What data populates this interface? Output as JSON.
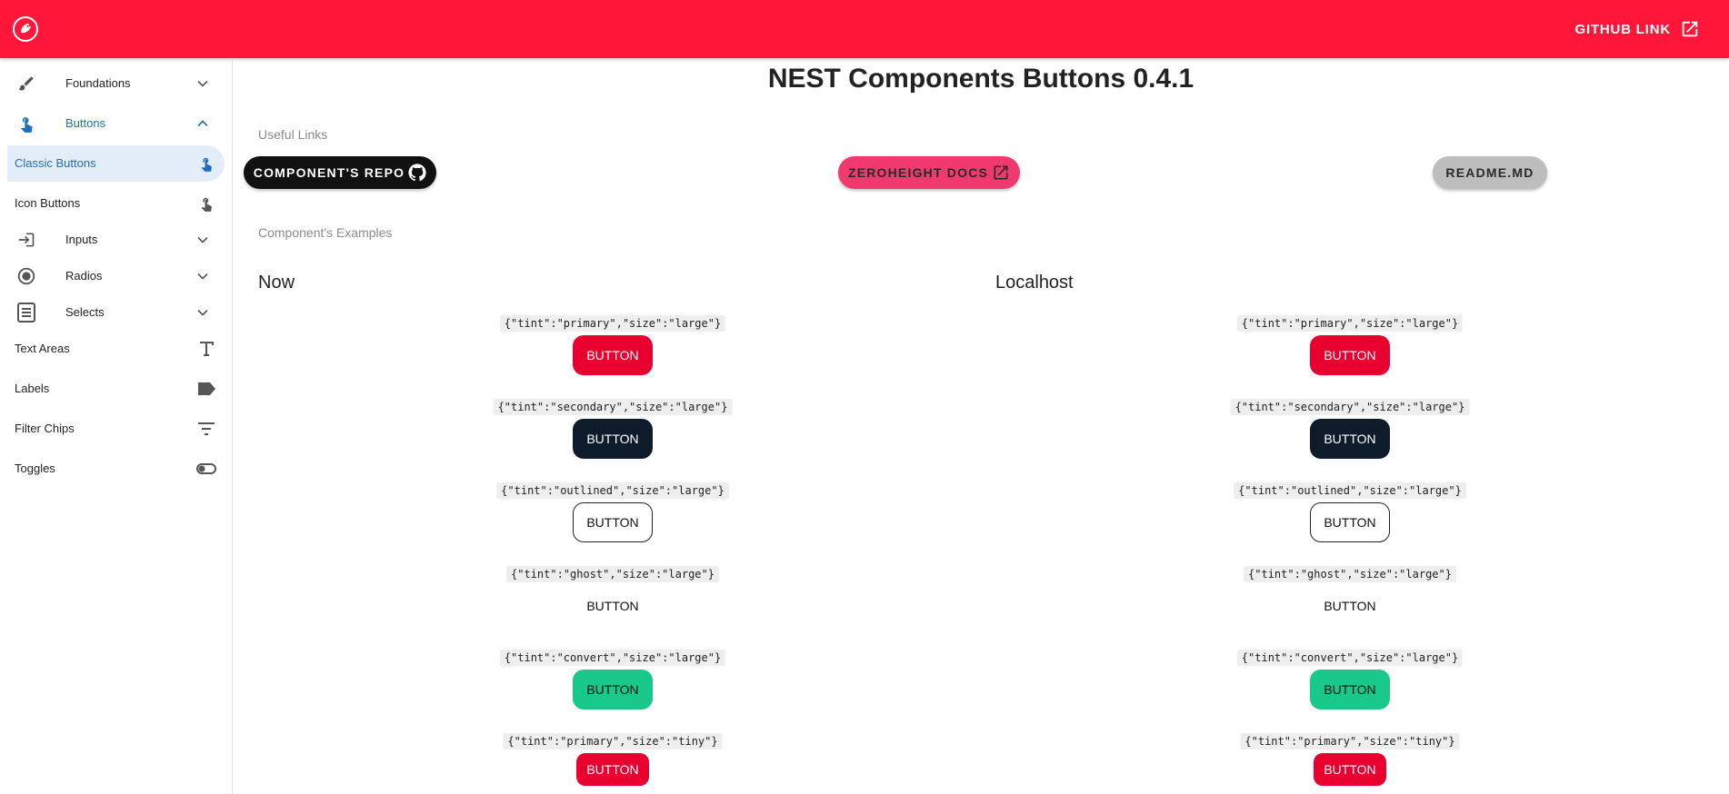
{
  "header": {
    "github_link_label": "GITHUB LINK"
  },
  "sidebar": {
    "items": [
      {
        "label": "Foundations"
      },
      {
        "label": "Buttons"
      },
      {
        "label": "Classic Buttons"
      },
      {
        "label": "Icon Buttons"
      },
      {
        "label": "Inputs"
      },
      {
        "label": "Radios"
      },
      {
        "label": "Selects"
      },
      {
        "label": "Text Areas"
      },
      {
        "label": "Labels"
      },
      {
        "label": "Filter Chips"
      },
      {
        "label": "Toggles"
      }
    ]
  },
  "main": {
    "title": "NEST Components Buttons 0.4.1",
    "useful_links_label": "Useful Links",
    "links": {
      "repo": "COMPONENT'S REPO",
      "zeroheight": "ZEROHEIGHT DOCS",
      "readme": "README.MD"
    },
    "examples_label": "Component's Examples",
    "columns": [
      "Now",
      "Localhost"
    ],
    "examples": [
      {
        "code": "{\"tint\":\"primary\",\"size\":\"large\"}",
        "label": "BUTTON"
      },
      {
        "code": "{\"tint\":\"secondary\",\"size\":\"large\"}",
        "label": "BUTTON"
      },
      {
        "code": "{\"tint\":\"outlined\",\"size\":\"large\"}",
        "label": "BUTTON"
      },
      {
        "code": "{\"tint\":\"ghost\",\"size\":\"large\"}",
        "label": "BUTTON"
      },
      {
        "code": "{\"tint\":\"convert\",\"size\":\"large\"}",
        "label": "BUTTON"
      },
      {
        "code": "{\"tint\":\"primary\",\"size\":\"tiny\"}",
        "label": "BUTTON"
      }
    ]
  },
  "colors": {
    "brand": "#ff1639",
    "primary": "#e8002f",
    "secondary": "#0d1b2a",
    "convert": "#19c98a",
    "zeroheight": "#f03a6f",
    "readme": "#bdbdbd",
    "selected_nav": "#1e6dbf"
  },
  "icons": {
    "logo": "bird-logo-icon",
    "github_link": "open-in-new-icon",
    "foundations": "paintbrush-icon",
    "buttons": "touch-icon",
    "inputs": "login-icon",
    "radios": "radio-icon",
    "selects": "list-icon",
    "text_areas": "text-icon",
    "labels": "label-icon",
    "filter_chips": "filter-icon",
    "toggles": "toggle-icon"
  }
}
